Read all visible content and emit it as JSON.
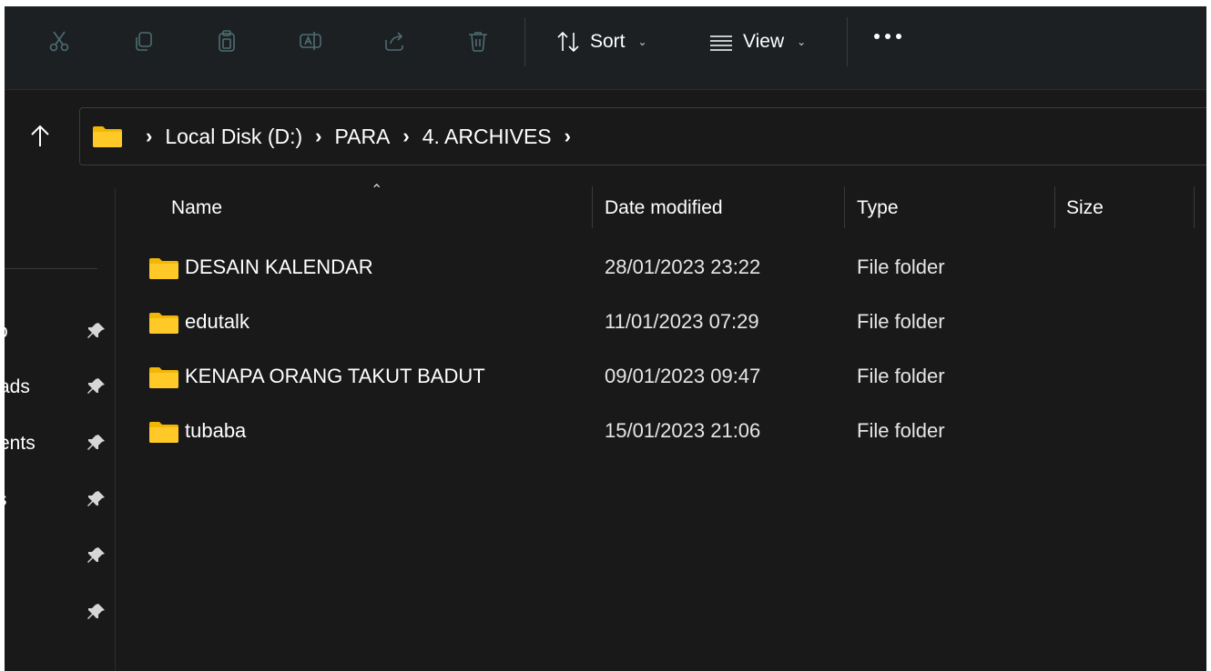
{
  "toolbar": {
    "buttons": [
      {
        "name": "cut-icon"
      },
      {
        "name": "copy-icon"
      },
      {
        "name": "paste-icon"
      },
      {
        "name": "rename-icon"
      },
      {
        "name": "share-icon"
      },
      {
        "name": "delete-icon"
      }
    ],
    "sort_label": "Sort",
    "view_label": "View",
    "more_label": "See more"
  },
  "address": {
    "crumbs": [
      "Local Disk (D:)",
      "PARA",
      "4. ARCHIVES"
    ]
  },
  "sidebar": {
    "items": [
      {
        "label": "o"
      },
      {
        "label": "ads"
      },
      {
        "label": "ents"
      },
      {
        "label": "s"
      },
      {
        "label": ""
      },
      {
        "label": ""
      }
    ]
  },
  "columns": {
    "name": "Name",
    "date": "Date modified",
    "type": "Type",
    "size": "Size"
  },
  "files": [
    {
      "name": "DESAIN KALENDAR",
      "date": "28/01/2023 23:22",
      "type": "File folder",
      "size": ""
    },
    {
      "name": "edutalk",
      "date": "11/01/2023 07:29",
      "type": "File folder",
      "size": ""
    },
    {
      "name": "KENAPA ORANG TAKUT BADUT",
      "date": "09/01/2023 09:47",
      "type": "File folder",
      "size": ""
    },
    {
      "name": "tubaba",
      "date": "15/01/2023 21:06",
      "type": "File folder",
      "size": ""
    }
  ],
  "colors": {
    "folder": "#f2b705",
    "background": "#191919",
    "toolbar_bg": "#1c2022",
    "disabled_icon": "#4d6d72"
  }
}
